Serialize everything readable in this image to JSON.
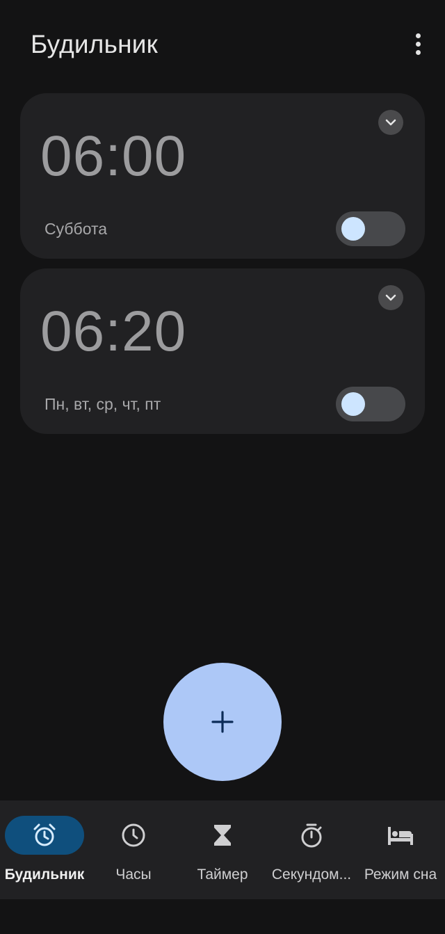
{
  "header": {
    "title": "Будильник",
    "menu_icon": "more-vert-icon"
  },
  "alarms": [
    {
      "time": "06:00",
      "days": "Суббота",
      "enabled": false
    },
    {
      "time": "06:20",
      "days": "Пн, вт, ср, чт, пт",
      "enabled": false
    }
  ],
  "fab": {
    "icon": "plus-icon",
    "label": "+"
  },
  "nav": {
    "items": [
      {
        "label": "Будильник",
        "icon": "alarm-icon",
        "active": true
      },
      {
        "label": "Часы",
        "icon": "clock-icon",
        "active": false
      },
      {
        "label": "Таймер",
        "icon": "hourglass-icon",
        "active": false
      },
      {
        "label": "Секундом...",
        "icon": "stopwatch-icon",
        "active": false
      },
      {
        "label": "Режим сна",
        "icon": "bed-icon",
        "active": false
      }
    ]
  },
  "colors": {
    "background": "#131314",
    "card": "#212123",
    "fab": "#adc8f7",
    "active_pill": "#0f4f7d",
    "toggle_knob": "#cde5ff"
  }
}
